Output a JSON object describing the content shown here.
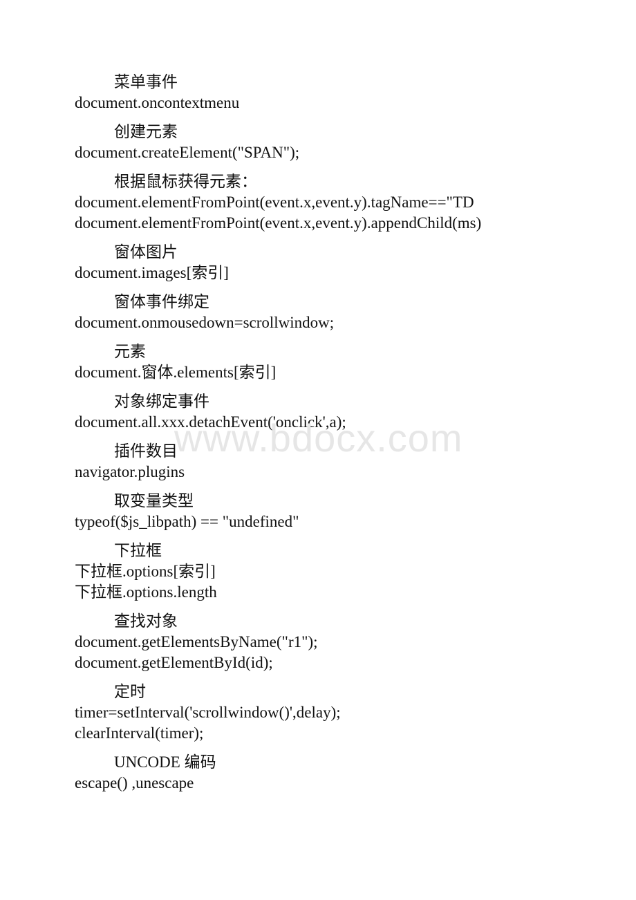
{
  "document": {
    "watermark": "www.bdocx.com",
    "sections": [
      {
        "heading": "菜单事件",
        "lines": [
          "document.oncontextmenu"
        ]
      },
      {
        "heading": "创建元素",
        "lines": [
          "document.createElement(\"SPAN\");"
        ]
      },
      {
        "heading": "根据鼠标获得元素：",
        "lines": [
          "document.elementFromPoint(event.x,event.y).tagName==\"TD",
          "document.elementFromPoint(event.x,event.y).appendChild(ms)"
        ]
      },
      {
        "heading": "窗体图片",
        "lines": [
          "document.images[索引]"
        ]
      },
      {
        "heading": "窗体事件绑定",
        "lines": [
          "document.onmousedown=scrollwindow;"
        ]
      },
      {
        "heading": "元素",
        "lines": [
          "document.窗体.elements[索引]"
        ]
      },
      {
        "heading": "对象绑定事件",
        "lines": [
          "document.all.xxx.detachEvent('onclick',a);"
        ]
      },
      {
        "heading": "插件数目",
        "lines": [
          "navigator.plugins"
        ]
      },
      {
        "heading": "取变量类型",
        "lines": [
          "typeof($js_libpath) == \"undefined\""
        ]
      },
      {
        "heading": "下拉框",
        "lines": [
          "下拉框.options[索引]",
          "下拉框.options.length"
        ]
      },
      {
        "heading": "查找对象",
        "lines": [
          "document.getElementsByName(\"r1\");",
          "document.getElementById(id);"
        ]
      },
      {
        "heading": "定时",
        "lines": [
          "timer=setInterval('scrollwindow()',delay);",
          "clearInterval(timer);"
        ]
      },
      {
        "heading": "UNCODE 编码",
        "lines": [
          "escape() ,unescape"
        ]
      }
    ]
  }
}
